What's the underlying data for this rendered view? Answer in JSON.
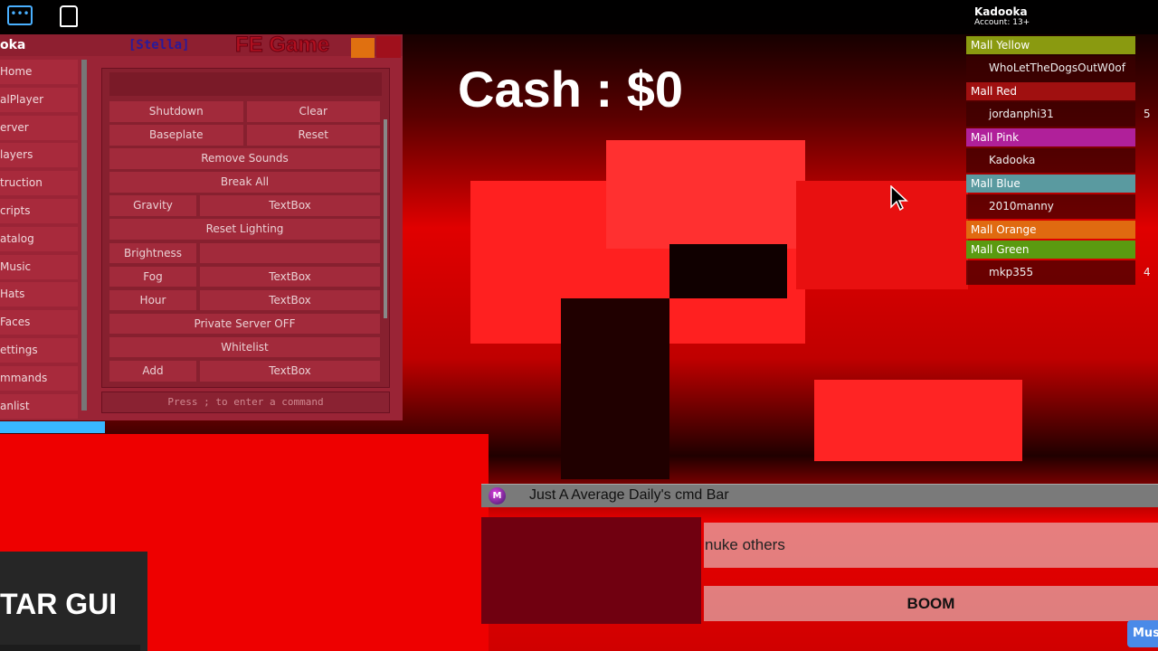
{
  "topbar": {
    "icons": [
      "chat-icon",
      "backpack-icon"
    ]
  },
  "cash": "Cash : $0",
  "panel": {
    "title": "oka",
    "tag": "[Stella]",
    "subtitle": "FE Game",
    "sidebar": [
      "Home",
      "alPlayer",
      "erver",
      "layers",
      "truction",
      "cripts",
      "atalog",
      "Music",
      "Hats",
      "Faces",
      "ettings",
      "mmands",
      "anlist"
    ],
    "rows": [
      [
        "Shutdown",
        "Clear"
      ],
      [
        "Baseplate",
        "Reset"
      ],
      [
        "Remove Sounds"
      ],
      [
        "Break All"
      ],
      [
        "Gravity",
        "TextBox"
      ],
      [
        "Reset Lighting"
      ],
      [
        "Brightness",
        ""
      ],
      [
        "Fog",
        "TextBox"
      ],
      [
        "Hour",
        "TextBox"
      ],
      [
        "Private Server OFF"
      ],
      [
        "Whitelist"
      ],
      [
        "Add",
        "TextBox"
      ]
    ],
    "command_placeholder": "Press ; to enter a command"
  },
  "leaderboard": {
    "user": "Kadooka",
    "account": "Account: 13+",
    "entries": [
      {
        "team": "Mall Yellow",
        "color": "#8a9a10",
        "player": "WhoLetTheDogsOutW0of",
        "value": ""
      },
      {
        "team": "Mall Red",
        "color": "#a01010",
        "player": "jordanphi31",
        "value": "5"
      },
      {
        "team": "Mall Pink",
        "color": "#b0209a",
        "player": "Kadooka",
        "value": ""
      },
      {
        "team": "Mall Blue",
        "color": "#5a9aa0",
        "player": "2010manny",
        "value": ""
      },
      {
        "team": "Mall Orange",
        "color": "#e06a10",
        "player": "",
        "value": ""
      },
      {
        "team": "Mall Green",
        "color": "#5a9a10",
        "player": "mkp355",
        "value": "4"
      }
    ]
  },
  "cmdbar": {
    "logo": "M",
    "title": "Just A Average Daily's cmd Bar",
    "input_value": "nuke others",
    "button": "BOOM"
  },
  "music_button": "Mus",
  "star_gui": "TAR GUI"
}
